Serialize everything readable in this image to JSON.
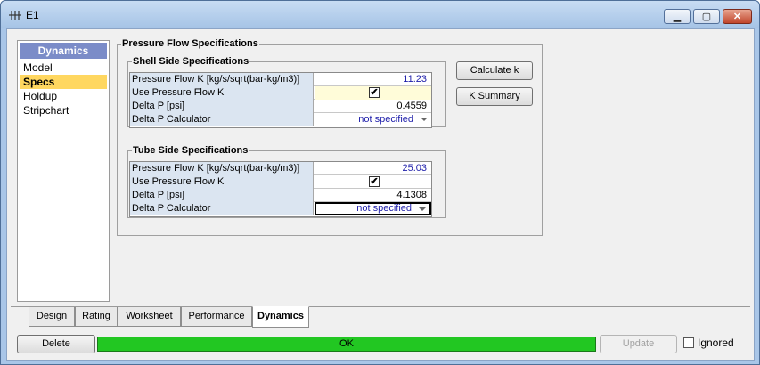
{
  "window": {
    "title": "E1",
    "minimize_glyph": "▁",
    "maximize_glyph": "▢",
    "close_glyph": "✕"
  },
  "nav": {
    "header": "Dynamics",
    "items": [
      {
        "label": "Model",
        "selected": false
      },
      {
        "label": "Specs",
        "selected": true
      },
      {
        "label": "Holdup",
        "selected": false
      },
      {
        "label": "Stripchart",
        "selected": false
      }
    ]
  },
  "pressure_flow": {
    "title": "Pressure Flow Specifications",
    "shell": {
      "title": "Shell Side Specifications",
      "rows": [
        {
          "label": "Pressure Flow K [kg/s/sqrt(bar-kg/m3)]",
          "value": "11.23"
        },
        {
          "label": "Use Pressure Flow K",
          "checked_glyph": "✔"
        },
        {
          "label": "Delta P [psi]",
          "value": "0.4559"
        },
        {
          "label": "Delta P Calculator",
          "value": "not specified"
        }
      ]
    },
    "tube": {
      "title": "Tube Side Specifications",
      "rows": [
        {
          "label": "Pressure Flow K [kg/s/sqrt(bar-kg/m3)]",
          "value": "25.03"
        },
        {
          "label": "Use Pressure Flow K",
          "checked_glyph": "✔"
        },
        {
          "label": "Delta P [psi]",
          "value": "4.1308"
        },
        {
          "label": "Delta P Calculator",
          "value": "not specified"
        }
      ]
    }
  },
  "buttons": {
    "calculate_k": "Calculate k",
    "k_summary": "K Summary",
    "delete": "Delete",
    "update": "Update"
  },
  "tabs": [
    {
      "label": "Design",
      "active": false
    },
    {
      "label": "Rating",
      "active": false
    },
    {
      "label": "Worksheet",
      "active": false
    },
    {
      "label": "Performance",
      "active": false
    },
    {
      "label": "Dynamics",
      "active": true
    }
  ],
  "status": {
    "text": "OK",
    "color": "#22c722"
  },
  "ignored": {
    "label": "Ignored",
    "checked": false
  },
  "colors": {
    "selected_nav": "#ffd760",
    "nav_header": "#7b8cc8",
    "value_blue": "#1e1eaa"
  }
}
